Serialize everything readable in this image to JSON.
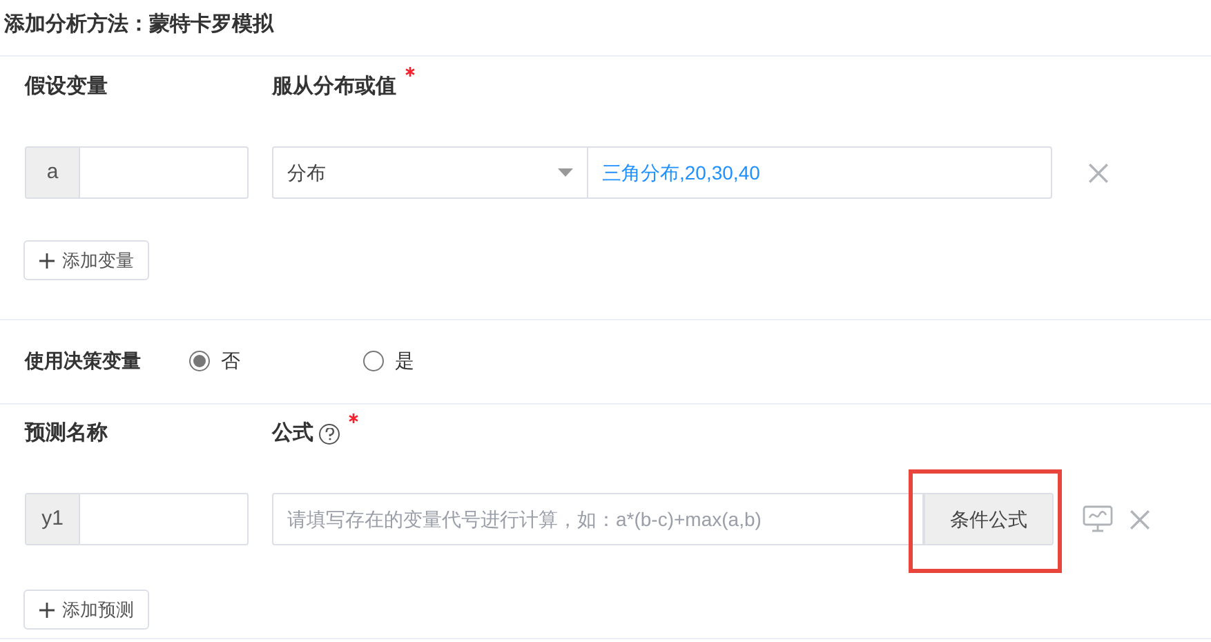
{
  "title": "添加分析方法：蒙特卡罗模拟",
  "variables": {
    "headers": [
      {
        "label": "假设变量",
        "required": false
      },
      {
        "label": "服从分布或值",
        "required": true
      }
    ],
    "rows": [
      {
        "code": "a",
        "name": "",
        "type": "分布",
        "value": "三角分布,20,30,40"
      }
    ],
    "add_button": "添加变量"
  },
  "decision": {
    "label": "使用决策变量",
    "options": [
      {
        "label": "否",
        "selected": true
      },
      {
        "label": "是",
        "selected": false
      }
    ]
  },
  "predictions": {
    "headers": [
      {
        "label": "预测名称",
        "required": false,
        "help": false
      },
      {
        "label": "公式",
        "required": true,
        "help": true
      }
    ],
    "rows": [
      {
        "code": "y1",
        "placeholder": "请填写存在的变量代号进行计算，如：a*(b-c)+max(a,b)",
        "formula_button": "条件公式",
        "highlighted": true
      }
    ],
    "add_button": "添加预测"
  }
}
